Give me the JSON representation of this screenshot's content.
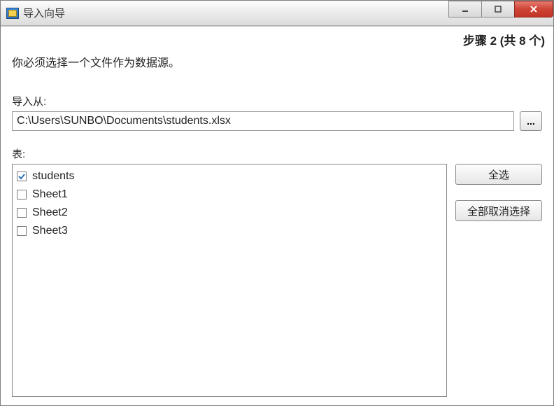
{
  "window": {
    "title": "导入向导"
  },
  "step": {
    "text": "步骤 2 (共 8 个)"
  },
  "instruction": "你必须选择一个文件作为数据源。",
  "importFrom": {
    "label": "导入从:",
    "value": "C:\\Users\\SUNBO\\Documents\\students.xlsx",
    "browse": "..."
  },
  "tables": {
    "label": "表:",
    "items": [
      {
        "name": "students",
        "checked": true
      },
      {
        "name": "Sheet1",
        "checked": false
      },
      {
        "name": "Sheet2",
        "checked": false
      },
      {
        "name": "Sheet3",
        "checked": false
      }
    ]
  },
  "buttons": {
    "selectAll": "全选",
    "deselectAll": "全部取消选择"
  }
}
